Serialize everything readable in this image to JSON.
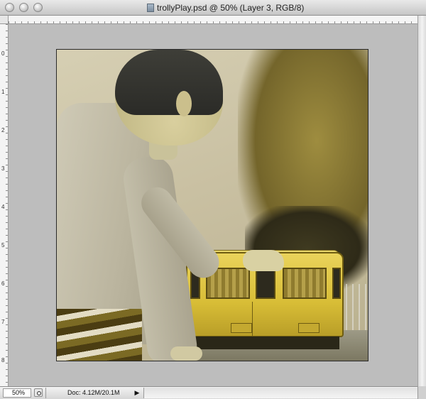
{
  "window": {
    "title": "trollyPlay.psd @ 50% (Layer 3, RGB/8)"
  },
  "rulers": {
    "left_marks": [
      "0",
      "1",
      "2",
      "3",
      "4",
      "5",
      "6",
      "7",
      "8"
    ]
  },
  "status_bar": {
    "zoom": "50%",
    "doc_info": "Doc: 4.12M/20.1M",
    "arrow": "▶"
  },
  "icons": {
    "close": "close-icon",
    "minimize": "minimize-icon",
    "zoom": "zoom-icon",
    "document": "psd-document-icon",
    "preview": "quick-mask-preview-icon",
    "menu": "status-menu-arrow-icon"
  },
  "artwork": {
    "description_colors": {
      "trolley": "#d8bd36",
      "canvas_bg": "#bdbdbd"
    }
  }
}
